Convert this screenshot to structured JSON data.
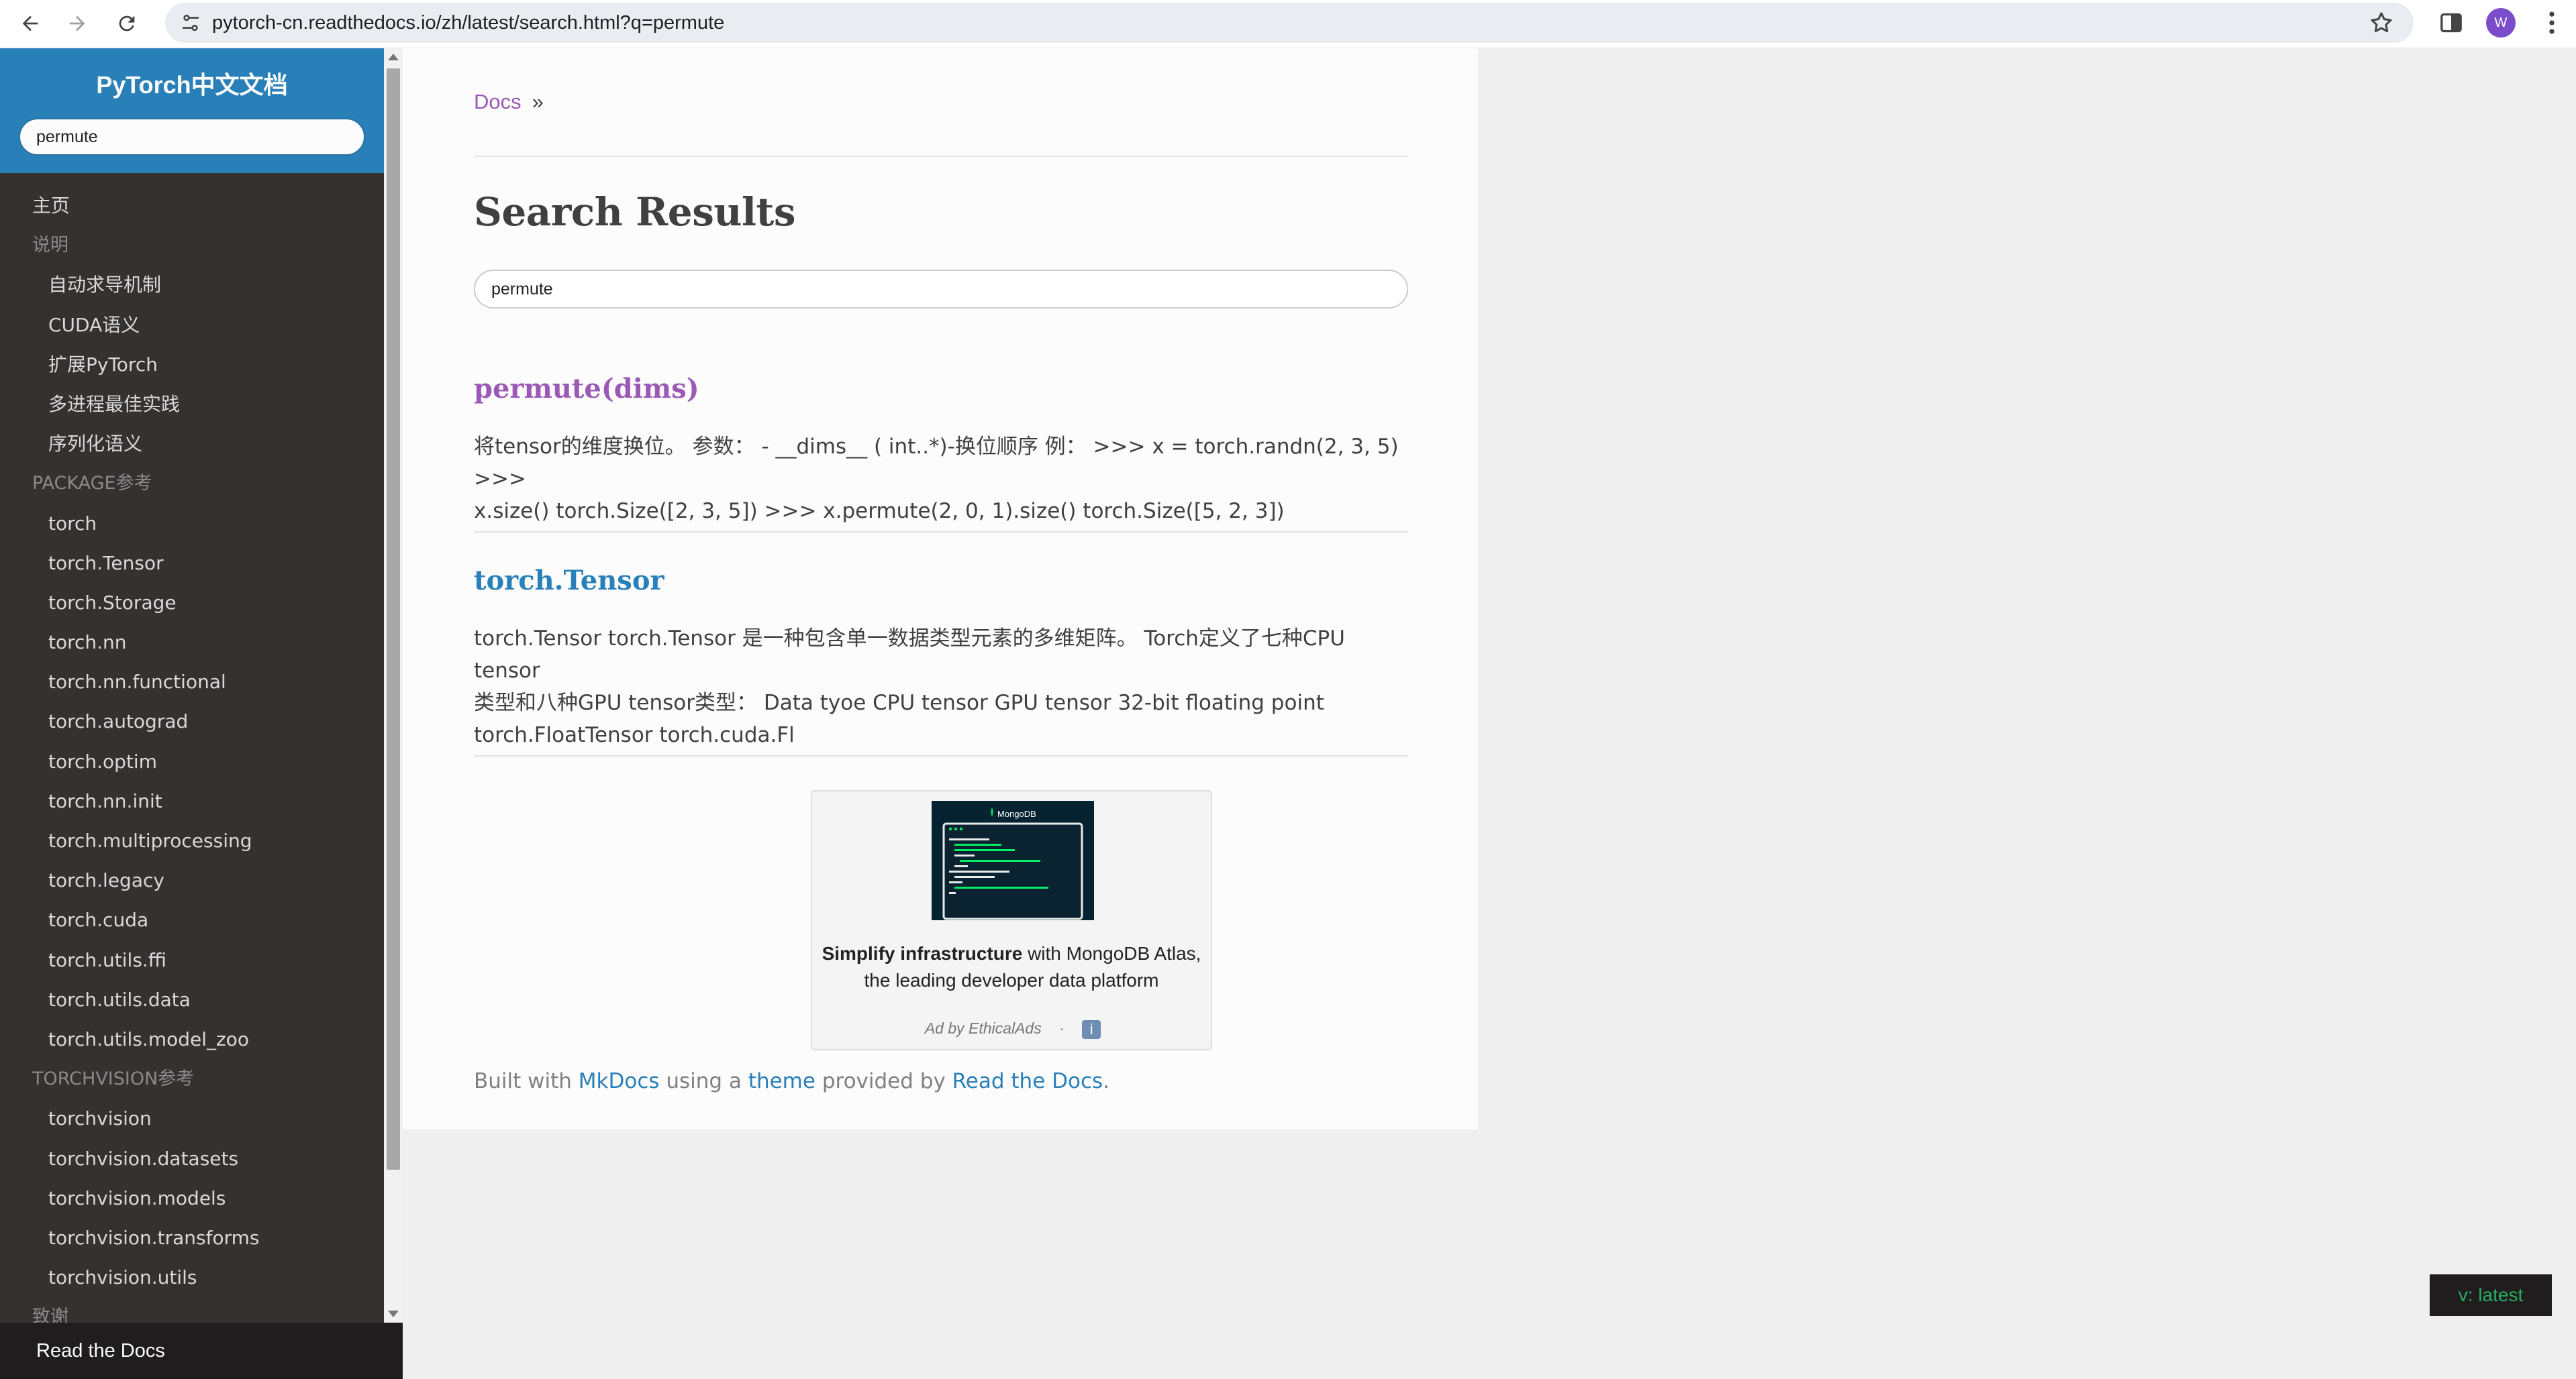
{
  "browser": {
    "url": "pytorch-cn.readthedocs.io/zh/latest/search.html?q=permute",
    "avatar_letter": "W"
  },
  "sidebar": {
    "project_title": "PyTorch中文文档",
    "search_value": "permute",
    "items": [
      {
        "label": "主页",
        "kind": "top"
      },
      {
        "label": "说明",
        "kind": "caption"
      },
      {
        "label": "自动求导机制",
        "kind": "level2"
      },
      {
        "label": "CUDA语义",
        "kind": "level2"
      },
      {
        "label": "扩展PyTorch",
        "kind": "level2"
      },
      {
        "label": "多进程最佳实践",
        "kind": "level2"
      },
      {
        "label": "序列化语义",
        "kind": "level2"
      },
      {
        "label": "PACKAGE参考",
        "kind": "caption"
      },
      {
        "label": "torch",
        "kind": "level2"
      },
      {
        "label": "torch.Tensor",
        "kind": "level2"
      },
      {
        "label": "torch.Storage",
        "kind": "level2"
      },
      {
        "label": "torch.nn",
        "kind": "level2"
      },
      {
        "label": "torch.nn.functional",
        "kind": "level2"
      },
      {
        "label": "torch.autograd",
        "kind": "level2"
      },
      {
        "label": "torch.optim",
        "kind": "level2"
      },
      {
        "label": "torch.nn.init",
        "kind": "level2"
      },
      {
        "label": "torch.multiprocessing",
        "kind": "level2"
      },
      {
        "label": "torch.legacy",
        "kind": "level2"
      },
      {
        "label": "torch.cuda",
        "kind": "level2"
      },
      {
        "label": "torch.utils.ffi",
        "kind": "level2"
      },
      {
        "label": "torch.utils.data",
        "kind": "level2"
      },
      {
        "label": "torch.utils.model_zoo",
        "kind": "level2"
      },
      {
        "label": "TORCHVISION参考",
        "kind": "caption"
      },
      {
        "label": "torchvision",
        "kind": "level2"
      },
      {
        "label": "torchvision.datasets",
        "kind": "level2"
      },
      {
        "label": "torchvision.models",
        "kind": "level2"
      },
      {
        "label": "torchvision.transforms",
        "kind": "level2"
      },
      {
        "label": "torchvision.utils",
        "kind": "level2"
      },
      {
        "label": "致谢",
        "kind": "caption"
      }
    ],
    "footer_label": "Read the Docs"
  },
  "content": {
    "breadcrumb": {
      "docs": "Docs",
      "sep": "»"
    },
    "title": "Search Results",
    "search_value": "permute",
    "results": [
      {
        "title": "permute(dims)",
        "text_line1": "将tensor的维度换位。 参数： - __dims__ ( int..*)-换位顺序 例： >>> x = torch.randn(2, 3, 5) >>>",
        "text_line2": "x.size() torch.Size([2, 3, 5]) >>> x.permute(2, 0, 1).size() torch.Size([5, 2, 3])"
      },
      {
        "title": "torch.Tensor",
        "text_line1": "torch.Tensor torch.Tensor 是一种包含单一数据类型元素的多维矩阵。 Torch定义了七种CPU tensor",
        "text_line2": "类型和八种GPU tensor类型： Data tyoe CPU tensor GPU tensor 32-bit floating point",
        "text_line3": "torch.FloatTensor torch.cuda.Fl"
      }
    ],
    "ad": {
      "image_brand": "MongoDB",
      "bold": "Simplify infrastructure",
      "rest_line1": " with MongoDB Atlas,",
      "line2": "the leading developer data platform",
      "by": "Ad by EthicalAds",
      "dot": "·",
      "info": "i"
    },
    "footer": {
      "built": "Built with ",
      "mkdocs": "MkDocs",
      "using": " using a ",
      "theme": "theme",
      "provided": " provided by ",
      "rtd": "Read the Docs",
      "end": "."
    }
  },
  "version_badge": "v: latest",
  "colors": {
    "sidebar_header": "#2980b9",
    "sidebar_bg": "#343131",
    "visited_link": "#9b59b6",
    "link": "#2980b9",
    "version_green": "#27ae60"
  }
}
